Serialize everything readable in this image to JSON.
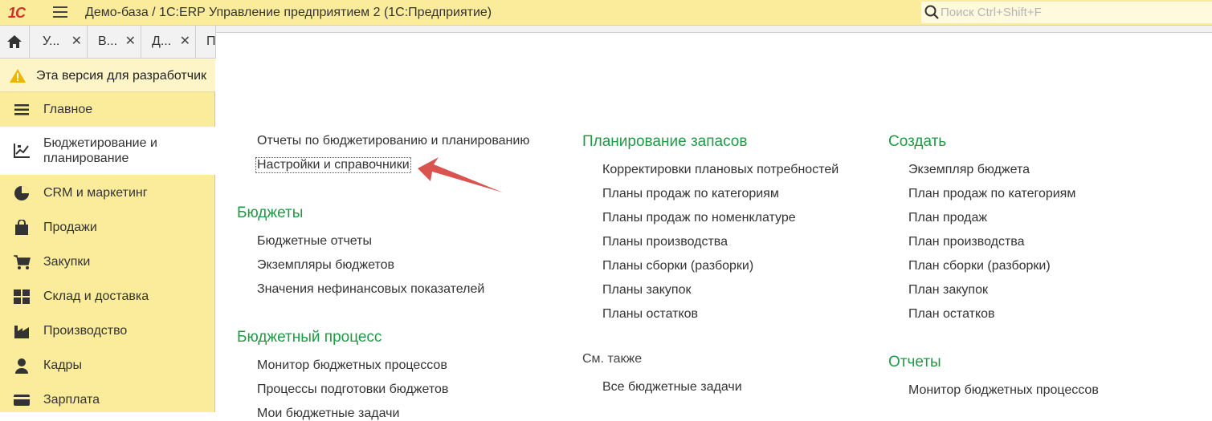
{
  "topbar": {
    "logo": "1С",
    "title": "Демо-база / 1С:ERP Управление предприятием 2  (1С:Предприятие)",
    "search_placeholder": "Поиск Ctrl+Shift+F"
  },
  "tabs": [
    {
      "label": "У...",
      "close": "✕"
    },
    {
      "label": "В...",
      "close": "✕"
    },
    {
      "label": "Д...",
      "close": "✕"
    },
    {
      "label": "П",
      "close": ""
    }
  ],
  "warning": {
    "text": "Эта версия для разработчик"
  },
  "sidebar": {
    "items": [
      {
        "label": "Главное",
        "icon": "menu-lines-icon"
      },
      {
        "label": "Бюджетирование и\nпланирование",
        "icon": "budget-chart-icon"
      },
      {
        "label": "CRM и маркетинг",
        "icon": "pie-chart-icon"
      },
      {
        "label": "Продажи",
        "icon": "shopping-bag-icon"
      },
      {
        "label": "Закупки",
        "icon": "cart-icon"
      },
      {
        "label": "Склад и доставка",
        "icon": "warehouse-grid-icon"
      },
      {
        "label": "Производство",
        "icon": "factory-icon"
      },
      {
        "label": "Кадры",
        "icon": "person-icon"
      },
      {
        "label": "Зарплата",
        "icon": "card-icon"
      }
    ]
  },
  "main": {
    "col1": {
      "links_top": [
        "Отчеты по бюджетированию и планированию",
        "Настройки и справочники"
      ],
      "section_budgets": {
        "title": "Бюджеты",
        "items": [
          "Бюджетные отчеты",
          "Экземпляры бюджетов",
          "Значения нефинансовых показателей"
        ]
      },
      "section_process": {
        "title": "Бюджетный процесс",
        "items": [
          "Монитор бюджетных процессов",
          "Процессы подготовки бюджетов",
          "Мои бюджетные задачи"
        ]
      }
    },
    "col2": {
      "section_planning": {
        "title": "Планирование запасов",
        "items": [
          "Корректировки плановых потребностей",
          "Планы продаж по категориям",
          "Планы продаж по номенклатуре",
          "Планы производства",
          "Планы сборки (разборки)",
          "Планы закупок",
          "Планы остатков"
        ]
      },
      "see_also": {
        "title": "См. также",
        "items": [
          "Все бюджетные задачи"
        ]
      }
    },
    "col3": {
      "section_create": {
        "title": "Создать",
        "items": [
          "Экземпляр бюджета",
          "План продаж по категориям",
          "План продаж",
          "План производства",
          "План сборки (разборки)",
          "План закупок",
          "План остатков"
        ]
      },
      "section_reports": {
        "title": "Отчеты",
        "items": [
          "Монитор бюджетных процессов"
        ]
      }
    }
  },
  "colors": {
    "accent_green": "#1f9a45",
    "sidebar_yellow": "#fbec9c",
    "arrow_red": "#d9534f"
  }
}
